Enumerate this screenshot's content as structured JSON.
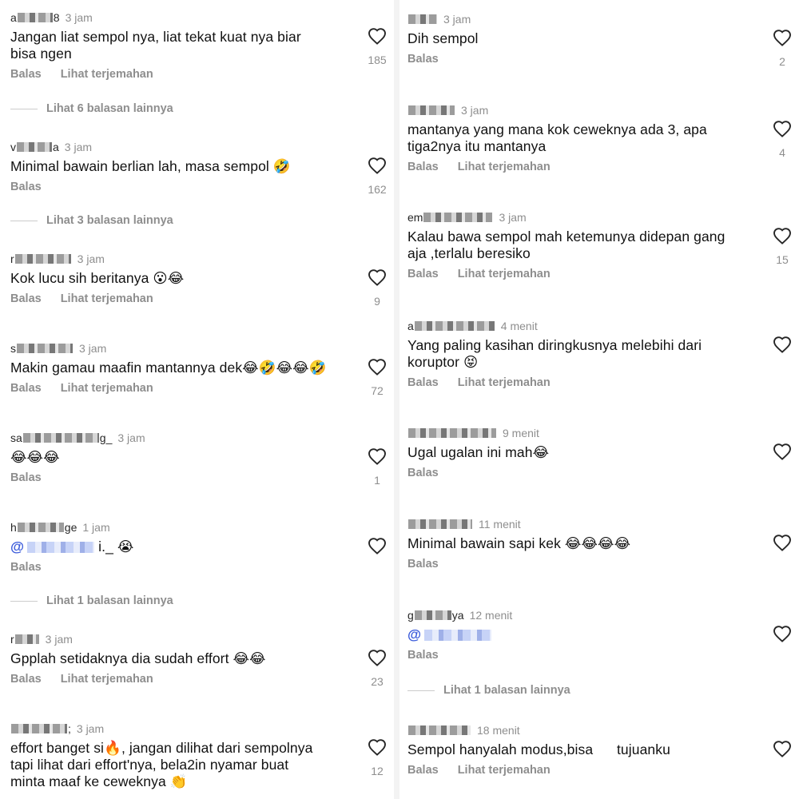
{
  "like_icon": "heart-outline-icon",
  "colors": {
    "meta": "#8e8e8e",
    "text": "#111111",
    "mention": "#3b5bdb"
  },
  "left": [
    {
      "user_visible": "a",
      "user_tail": "8",
      "time": "3 jam",
      "text": "Jangan liat sempol nya, liat tekat kuat nya biar\nbisa ngen",
      "reply": "Balas",
      "translate": "Lihat terjemahan",
      "likes": "185",
      "more": "Lihat 6 balasan lainnya"
    },
    {
      "user_visible": "v",
      "user_tail": "a",
      "time": "3 jam",
      "text": "Minimal bawain berlian lah, masa sempol 🤣",
      "reply": "Balas",
      "translate": "",
      "likes": "162",
      "more": "Lihat 3 balasan lainnya"
    },
    {
      "user_visible": "r",
      "user_tail": "",
      "time": "3 jam",
      "text": "Kok lucu sih beritanya 😮😂",
      "reply": "Balas",
      "translate": "Lihat terjemahan",
      "likes": "9",
      "more": ""
    },
    {
      "user_visible": "s",
      "user_tail": "",
      "time": "3 jam",
      "text": "Makin gamau maafin mantannya dek😂🤣😂😂🤣",
      "reply": "Balas",
      "translate": "Lihat terjemahan",
      "likes": "72",
      "more": ""
    },
    {
      "user_visible": "sa",
      "user_tail": "g_",
      "time": "3 jam",
      "text": "😂😂😂",
      "reply": "Balas",
      "translate": "",
      "likes": "1",
      "more": ""
    },
    {
      "user_visible": "h",
      "user_tail": "ge",
      "time": "1 jam",
      "text": "i._ 😭",
      "mention": true,
      "reply": "Balas",
      "translate": "",
      "likes": "",
      "more": "Lihat 1 balasan lainnya"
    },
    {
      "user_visible": "r",
      "user_tail": "",
      "time": "3 jam",
      "text": "Gpplah setidaknya dia sudah effort 😂😂",
      "reply": "Balas",
      "translate": "Lihat terjemahan",
      "likes": "23",
      "more": ""
    },
    {
      "user_visible": "",
      "user_tail": ";",
      "time": "3 jam",
      "text": "effort banget si🔥, jangan dilihat dari sempolnya\ntapi lihat dari effort'nya, bela2in nyamar buat\nminta maaf ke ceweknya 👏",
      "reply": "",
      "translate": "",
      "likes": "12",
      "more": ""
    }
  ],
  "right": [
    {
      "user_visible": "",
      "user_tail": "",
      "time": "3 jam",
      "text": "Dih sempol",
      "reply": "Balas",
      "translate": "",
      "likes": "2",
      "more": ""
    },
    {
      "user_visible": "",
      "user_tail": "",
      "time": "3 jam",
      "text": "mantanya yang mana kok ceweknya ada 3, apa\ntiga2nya itu mantanya",
      "reply": "Balas",
      "translate": "Lihat terjemahan",
      "likes": "4",
      "more": ""
    },
    {
      "user_visible": "em",
      "user_tail": "",
      "time": "3 jam",
      "text": "Kalau bawa sempol mah ketemunya didepan gang\naja ,terlalu beresiko",
      "reply": "Balas",
      "translate": "Lihat terjemahan",
      "likes": "15",
      "more": ""
    },
    {
      "user_visible": "a",
      "user_tail": "",
      "time": "4 menit",
      "text": "Yang paling kasihan diringkusnya melebihi dari\nkoruptor 😝",
      "reply": "Balas",
      "translate": "Lihat terjemahan",
      "likes": "",
      "more": ""
    },
    {
      "user_visible": "",
      "user_tail": "",
      "time": "9 menit",
      "text": "Ugal ugalan ini mah😂",
      "reply": "Balas",
      "translate": "",
      "likes": "",
      "more": ""
    },
    {
      "user_visible": "",
      "user_tail": "",
      "time": "11 menit",
      "text": "Minimal bawain sapi kek 😂😂😂😂",
      "reply": "Balas",
      "translate": "",
      "likes": "",
      "more": ""
    },
    {
      "user_visible": "g",
      "user_tail": "ya",
      "time": "12 menit",
      "text": "",
      "mention": true,
      "reply": "Balas",
      "translate": "",
      "likes": "",
      "more": "Lihat 1 balasan lainnya"
    },
    {
      "user_visible": "",
      "user_tail": "",
      "time": "18 menit",
      "text": "Sempol hanyalah modus,bisa      tujuanku",
      "reply": "Balas",
      "translate": "Lihat terjemahan",
      "likes": "",
      "more": ""
    }
  ]
}
